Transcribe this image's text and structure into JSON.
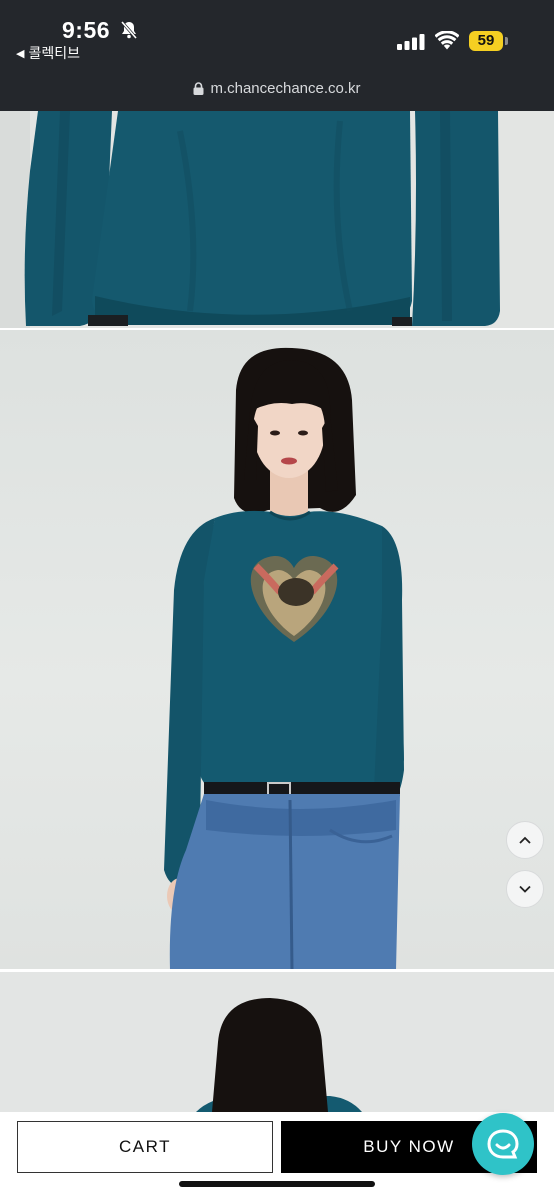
{
  "status_bar": {
    "time": "9:56",
    "back_label": "콜렉티브",
    "battery": "59",
    "icons": [
      "bell-slash-icon",
      "signal-icon",
      "wifi-icon",
      "battery-icon"
    ]
  },
  "browser": {
    "url": "m.chancechance.co.kr"
  },
  "product_images": [
    {
      "name": "teal-long-sleeve-top-closeup"
    },
    {
      "name": "model-front-heart-cherub-print"
    },
    {
      "name": "model-back-view"
    }
  ],
  "scroll": {
    "up_icon": "chevron-up-icon",
    "down_icon": "chevron-down-icon"
  },
  "actions": {
    "cart_label": "CART",
    "buy_label": "BUY NOW",
    "chat_icon": "chat-bubble-icon"
  },
  "colors": {
    "topbar": "#24272c",
    "garment": "#13556a",
    "buy_button": "#000000",
    "chat_button": "#2fc3c8",
    "battery": "#f5cf22"
  }
}
